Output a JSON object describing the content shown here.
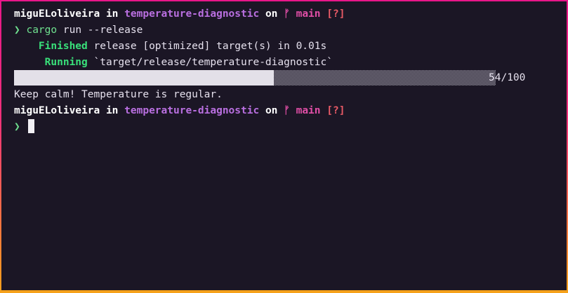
{
  "prompt": {
    "user": "miguELoliveira",
    "in": "in",
    "dir": "temperature-diagnostic",
    "on": "on",
    "branch_icon": "",
    "branch": "main",
    "status": "[?]",
    "chevron": "❯"
  },
  "command": {
    "program": "cargo",
    "args": " run --release"
  },
  "output": {
    "finished_label": "Finished",
    "finished_text": " release [optimized] target(s) in 0.01s",
    "running_label": "Running",
    "running_text": " `target/release/temperature-diagnostic`",
    "message": "Keep calm! Temperature is regular."
  },
  "progress": {
    "current": 54,
    "total": 100,
    "label": "54/100",
    "fraction": 0.54
  },
  "colors": {
    "background": "#1b1625",
    "green": "#39e07a",
    "purple": "#b96fe0",
    "pink": "#e04ea6",
    "red": "#e85a66"
  }
}
